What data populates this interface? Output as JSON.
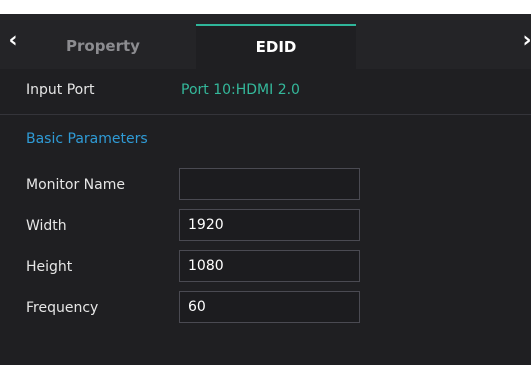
{
  "tabs": {
    "property_label": "Property",
    "edid_label": "EDID"
  },
  "input_port": {
    "label": "Input Port",
    "value": "Port 10:HDMI 2.0"
  },
  "basic_parameters": {
    "title": "Basic Parameters",
    "fields": [
      {
        "label": "Monitor Name",
        "value": ""
      },
      {
        "label": "Width",
        "value": "1920"
      },
      {
        "label": "Height",
        "value": "1080"
      },
      {
        "label": "Frequency",
        "value": "60"
      }
    ]
  },
  "colors": {
    "panel_bg": "#1f1f22",
    "accent_green": "#34b89b",
    "section_blue": "#2f9bd6",
    "text": "#e6e6e6"
  }
}
